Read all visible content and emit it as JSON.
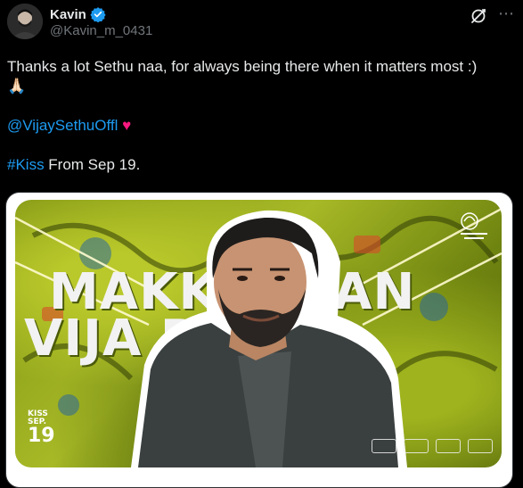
{
  "author": {
    "display_name": "Kavin",
    "handle": "@Kavin_m_0431"
  },
  "icons": {
    "verified": "verified-badge-icon",
    "grok": "grok-icon",
    "more": "more-options-icon"
  },
  "tweet": {
    "line1": "Thanks a lot Sethu naa, for always being there when it matters most :)",
    "emoji": "🙏🏻",
    "mention": "@VijaySethuOffl",
    "heart": "♥",
    "hashtag": "#Kiss",
    "hashtag_suffix": " From Sep 19."
  },
  "poster": {
    "title_line1": "MAKK      ELVAN",
    "title_line2": "VIJA        PATHI",
    "badge_kiss": "KISS",
    "badge_date": "SEP.",
    "badge_day": "19"
  },
  "colors": {
    "link": "#1d9bf0",
    "heart": "#f91880",
    "verified": "#1d9bf0",
    "poster_green": "#a7b926"
  }
}
